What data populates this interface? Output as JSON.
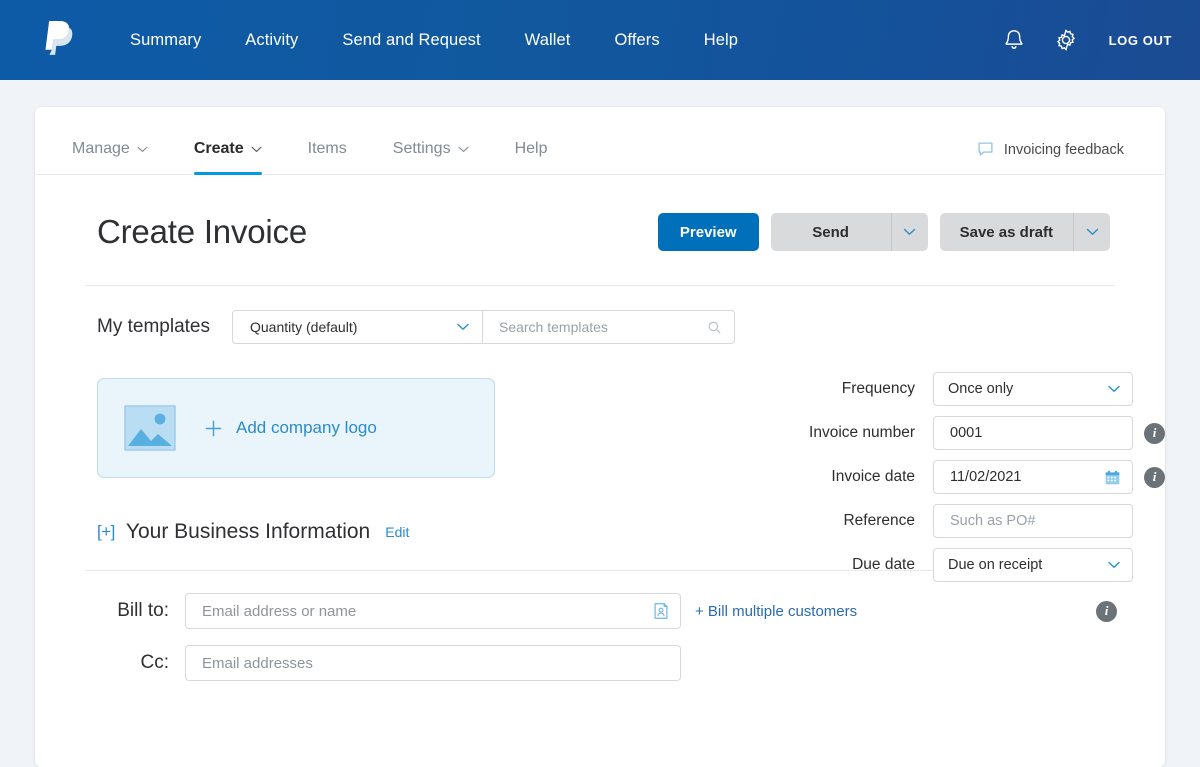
{
  "header": {
    "logo_icon": "paypal-logo",
    "nav": [
      {
        "label": "Summary"
      },
      {
        "label": "Activity"
      },
      {
        "label": "Send and Request"
      },
      {
        "label": "Wallet"
      },
      {
        "label": "Offers"
      },
      {
        "label": "Help"
      }
    ],
    "bell_icon": "notification-bell-icon",
    "gear_icon": "settings-gear-icon",
    "logout_label": "LOG OUT",
    "background_color": "#11599f"
  },
  "tabs": [
    {
      "label": "Manage",
      "has_caret": true,
      "active": false
    },
    {
      "label": "Create",
      "has_caret": true,
      "active": true
    },
    {
      "label": "Items",
      "has_caret": false,
      "active": false
    },
    {
      "label": "Settings",
      "has_caret": true,
      "active": false
    },
    {
      "label": "Help",
      "has_caret": false,
      "active": false
    }
  ],
  "feedback": {
    "label": "Invoicing feedback",
    "icon": "speech-bubble-icon"
  },
  "page": {
    "title": "Create Invoice"
  },
  "actions": {
    "preview_label": "Preview",
    "send_label": "Send",
    "save_label": "Save as draft",
    "primary_color": "#0070ba"
  },
  "templates": {
    "label": "My templates",
    "selected": "Quantity (default)",
    "search_placeholder": "Search templates",
    "search_value": "",
    "search_icon": "search-icon"
  },
  "logo_upload": {
    "label": "Add company logo",
    "plus": "+",
    "image_icon": "image-placeholder-icon"
  },
  "business": {
    "expand": "[+]",
    "title": "Your Business Information",
    "edit_label": "Edit"
  },
  "form": {
    "frequency": {
      "label": "Frequency",
      "value": "Once only",
      "type": "select"
    },
    "invoice_number": {
      "label": "Invoice number",
      "value": "0001",
      "type": "text",
      "info": true
    },
    "invoice_date": {
      "label": "Invoice date",
      "value": "11/02/2021",
      "type": "date",
      "info": true,
      "icon": "calendar-icon"
    },
    "reference": {
      "label": "Reference",
      "value": "",
      "placeholder": "Such as PO#",
      "type": "text"
    },
    "due_date": {
      "label": "Due date",
      "value": "Due on receipt",
      "type": "select"
    }
  },
  "billing": {
    "bill_to_label": "Bill to:",
    "bill_to_placeholder": "Email address or name",
    "bill_to_value": "",
    "contact_icon": "address-book-icon",
    "bill_multiple_label": "+ Bill multiple customers",
    "cc_label": "Cc:",
    "cc_placeholder": "Email addresses",
    "cc_value": ""
  }
}
